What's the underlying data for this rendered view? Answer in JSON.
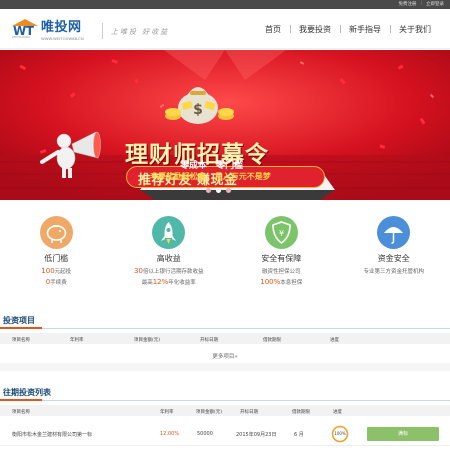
{
  "topbar": {
    "login": "免费注册",
    "register": "立即登录"
  },
  "brand": {
    "logo_letters": "WT",
    "logo_sub": "WEITOUWANG",
    "name": "唯投网",
    "domain": "WWW.WEITOUW88.CN",
    "slogan": "上唯投 好收益"
  },
  "nav": {
    "items": [
      "首页",
      "我要投资",
      "新手指导",
      "关于我们"
    ]
  },
  "banner": {
    "title": "理财师招募令",
    "subtitle": "推荐好友  赚现金",
    "row1": "零成本  零门槛",
    "row2": "丰厚奖励轻松拿  月入万元不是梦",
    "coin": "$",
    "slides": 3,
    "active_slide": 1
  },
  "features": [
    {
      "title": "低门槛",
      "line1_value": "100",
      "line1_text": "元起投",
      "line2_value": "0",
      "line2_text": "手续费",
      "color": "#f0a866",
      "icon": "piggy-bank-icon"
    },
    {
      "title": "高收益",
      "line1_value": "30",
      "line1_text": "倍以上银行活期存款收益",
      "line2_prefix": "最高",
      "line2_value": "12%",
      "line2_text": "年化收益率",
      "color": "#4fb8a8",
      "icon": "rocket-icon"
    },
    {
      "title": "安全有保障",
      "line1_text": "融资性担保公司",
      "line2_value": "100%",
      "line2_text": "本息担保",
      "color": "#7cc46a",
      "icon": "shield-icon"
    },
    {
      "title": "资金安全",
      "line1_text": "专业第三方资金托管机构",
      "color": "#4a8fd8",
      "icon": "umbrella-icon"
    }
  ],
  "projects": {
    "title": "投资项目",
    "headers": [
      "项目名称",
      "年利率",
      "项目金额(元)",
      "开标日期",
      "借款期限",
      "进度"
    ],
    "more": "更多项目»"
  },
  "past": {
    "title": "往期投资列表",
    "headers": [
      "项目名称",
      "年利率",
      "项目金额(元)",
      "开标日期",
      "借款期限",
      "进度"
    ],
    "rows": [
      {
        "name": "衡阳市松木金兰建材有限公司第一标",
        "rate": "12.00%",
        "amount": "50000",
        "date": "2015年09月23日",
        "term": "6 月",
        "progress_label": "100%",
        "progress": 1.0,
        "status": "满标"
      }
    ]
  }
}
